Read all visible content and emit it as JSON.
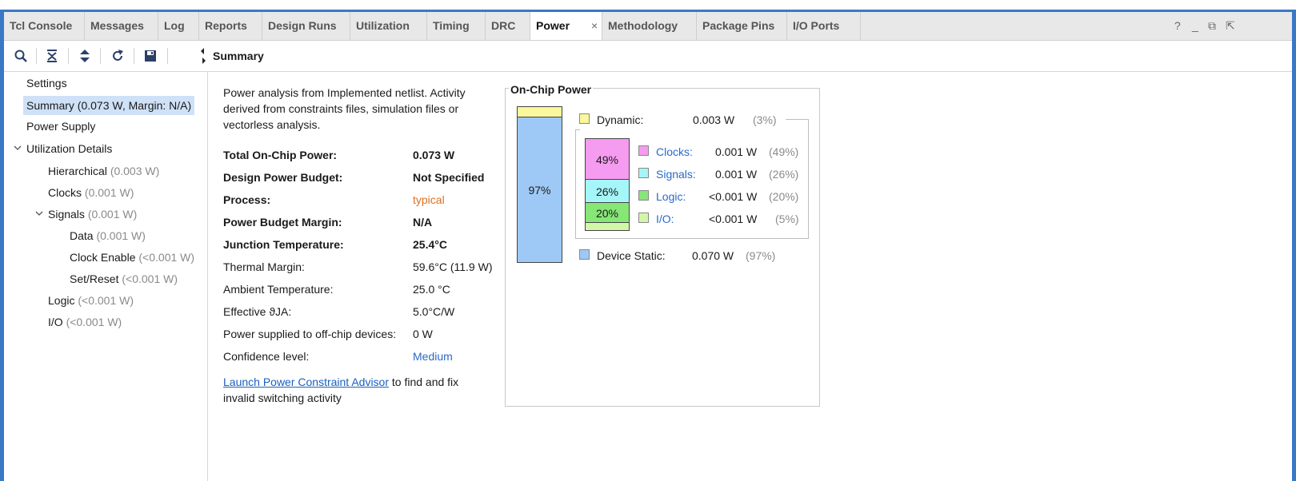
{
  "tabs": [
    {
      "label": "Tcl Console"
    },
    {
      "label": "Messages"
    },
    {
      "label": "Log"
    },
    {
      "label": "Reports"
    },
    {
      "label": "Design Runs"
    },
    {
      "label": "Utilization"
    },
    {
      "label": "Timing"
    },
    {
      "label": "DRC"
    },
    {
      "label": "Power"
    },
    {
      "label": "Methodology"
    },
    {
      "label": "Package Pins"
    },
    {
      "label": "I/O Ports"
    }
  ],
  "active_tab": "Power",
  "tab_close": "×",
  "window_controls": {
    "help": "?",
    "minimize": "_",
    "restore": "⧉",
    "float": "⇱"
  },
  "toolbar": {
    "icons": [
      "search-icon",
      "collapse-all-icon",
      "expand-all-icon",
      "refresh-icon",
      "save-icon"
    ]
  },
  "panel_title": "Summary",
  "tree": {
    "settings": "Settings",
    "summary_label": "Summary (0.073 W, Margin: N/A)",
    "power_supply": "Power Supply",
    "utilization_details": "Utilization Details",
    "hierarchical": {
      "label": "Hierarchical",
      "value": "(0.003 W)"
    },
    "clocks": {
      "label": "Clocks",
      "value": "(0.001 W)"
    },
    "signals": {
      "label": "Signals",
      "value": "(0.001 W)"
    },
    "data": {
      "label": "Data",
      "value": "(0.001 W)"
    },
    "clock_enable": {
      "label": "Clock Enable",
      "value": "(<0.001 W)"
    },
    "set_reset": {
      "label": "Set/Reset",
      "value": "(<0.001 W)"
    },
    "logic": {
      "label": "Logic",
      "value": "(<0.001 W)"
    },
    "io": {
      "label": "I/O",
      "value": "(<0.001 W)"
    }
  },
  "summary": {
    "description": "Power analysis from Implemented netlist. Activity derived from constraints files, simulation files or vectorless analysis.",
    "rows": [
      {
        "label": "Total On-Chip Power:",
        "value": "0.073 W"
      },
      {
        "label": "Design Power Budget:",
        "value": "Not Specified"
      },
      {
        "label": "Process:",
        "value": "typical"
      },
      {
        "label": "Power Budget Margin:",
        "value": "N/A"
      },
      {
        "label": "Junction Temperature:",
        "value": "25.4°C"
      },
      {
        "label": "Thermal Margin:",
        "value": "59.6°C (11.9 W)"
      },
      {
        "label": "Ambient Temperature:",
        "value": "25.0 °C"
      },
      {
        "label": "Effective ϑJA:",
        "value": "5.0°C/W"
      },
      {
        "label": "Power supplied to off-chip devices:",
        "value": "0 W"
      },
      {
        "label": "Confidence level:",
        "value": "Medium"
      }
    ],
    "advisor_link": "Launch Power Constraint Advisor",
    "advisor_text": " to find and fix invalid switching activity"
  },
  "on_chip_power": {
    "title": "On-Chip Power",
    "static_bar_label": "97%",
    "dynamic": {
      "label": "Dynamic:",
      "value": "0.003 W",
      "pct": "(3%)",
      "color": "#fbf79c"
    },
    "device_static": {
      "label": "Device Static:",
      "value": "0.070 W",
      "pct": "(97%)",
      "color": "#9ec9f6"
    },
    "breakdown": [
      {
        "label": "Clocks:",
        "value": "0.001 W",
        "pct": "(49%)",
        "bar_label": "49%",
        "color": "#f59bf0"
      },
      {
        "label": "Signals:",
        "value": "0.001 W",
        "pct": "(26%)",
        "bar_label": "26%",
        "color": "#a4f6f8"
      },
      {
        "label": "Logic:",
        "value": "<0.001 W",
        "pct": "(20%)",
        "bar_label": "20%",
        "color": "#86e676"
      },
      {
        "label": "I/O:",
        "value": "<0.001 W",
        "pct": "(5%)",
        "bar_label": "",
        "color": "#d2f7a8"
      }
    ]
  }
}
